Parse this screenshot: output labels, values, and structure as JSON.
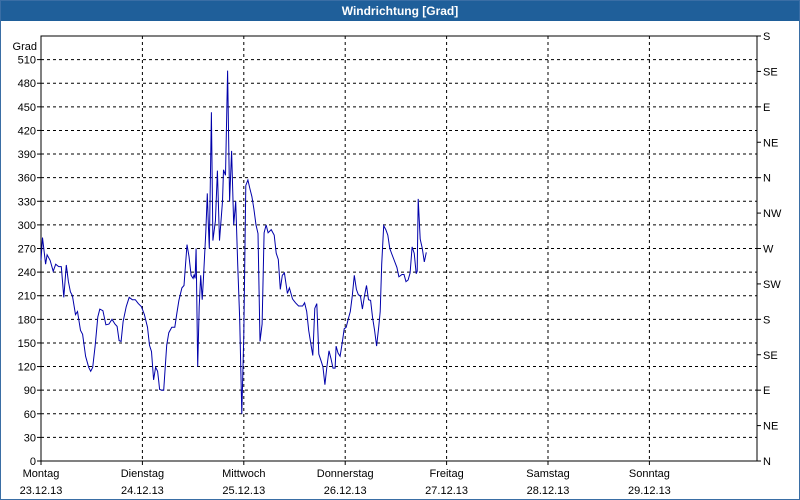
{
  "window": {
    "title": "Windrichtung [Grad]"
  },
  "chart_data": {
    "type": "line",
    "title": "Windrichtung [Grad]",
    "ylabel": "Grad",
    "ylim": [
      0,
      540
    ],
    "y_ticks": [
      0,
      30,
      60,
      90,
      120,
      150,
      180,
      210,
      240,
      270,
      300,
      330,
      360,
      390,
      420,
      450,
      480,
      510
    ],
    "right_axis_labels": [
      "N",
      "NE",
      "E",
      "SE",
      "S",
      "SW",
      "W",
      "NW",
      "N",
      "NE",
      "E",
      "SE",
      "S"
    ],
    "x_range_days": [
      0,
      7
    ],
    "x_ticks": [
      {
        "day": "Montag",
        "date": "23.12.13"
      },
      {
        "day": "Dienstag",
        "date": "24.12.13"
      },
      {
        "day": "Mittwoch",
        "date": "25.12.13"
      },
      {
        "day": "Donnerstag",
        "date": "26.12.13"
      },
      {
        "day": "Freitag",
        "date": "27.12.13"
      },
      {
        "day": "Samstag",
        "date": "28.12.13"
      },
      {
        "day": "Sonntag",
        "date": "29.12.13"
      }
    ],
    "grid": true,
    "series": [
      {
        "color": "#0000aa",
        "points": [
          [
            0.0,
            255
          ],
          [
            0.015,
            284
          ],
          [
            0.045,
            250
          ],
          [
            0.06,
            262
          ],
          [
            0.09,
            255
          ],
          [
            0.12,
            241
          ],
          [
            0.145,
            250
          ],
          [
            0.175,
            247
          ],
          [
            0.2,
            247
          ],
          [
            0.225,
            208
          ],
          [
            0.25,
            249
          ],
          [
            0.27,
            228
          ],
          [
            0.29,
            215
          ],
          [
            0.31,
            210
          ],
          [
            0.34,
            186
          ],
          [
            0.36,
            190
          ],
          [
            0.39,
            166
          ],
          [
            0.41,
            161
          ],
          [
            0.44,
            133
          ],
          [
            0.47,
            119
          ],
          [
            0.49,
            114
          ],
          [
            0.51,
            119
          ],
          [
            0.535,
            147
          ],
          [
            0.56,
            183
          ],
          [
            0.58,
            193
          ],
          [
            0.61,
            191
          ],
          [
            0.64,
            173
          ],
          [
            0.67,
            174
          ],
          [
            0.7,
            180
          ],
          [
            0.73,
            174
          ],
          [
            0.75,
            171
          ],
          [
            0.77,
            153
          ],
          [
            0.79,
            152
          ],
          [
            0.81,
            177
          ],
          [
            0.84,
            196
          ],
          [
            0.87,
            208
          ],
          [
            0.9,
            205
          ],
          [
            0.93,
            205
          ],
          [
            0.96,
            200
          ],
          [
            0.99,
            196
          ],
          [
            1.02,
            186
          ],
          [
            1.05,
            170
          ],
          [
            1.07,
            147
          ],
          [
            1.09,
            139
          ],
          [
            1.11,
            103
          ],
          [
            1.13,
            119
          ],
          [
            1.15,
            114
          ],
          [
            1.16,
            103
          ],
          [
            1.17,
            91
          ],
          [
            1.19,
            90
          ],
          [
            1.21,
            90
          ],
          [
            1.24,
            147
          ],
          [
            1.26,
            163
          ],
          [
            1.29,
            170
          ],
          [
            1.32,
            170
          ],
          [
            1.34,
            188
          ],
          [
            1.36,
            204
          ],
          [
            1.39,
            220
          ],
          [
            1.41,
            223
          ],
          [
            1.44,
            275
          ],
          [
            1.46,
            260
          ],
          [
            1.48,
            236
          ],
          [
            1.5,
            232
          ],
          [
            1.51,
            237
          ],
          [
            1.52,
            232
          ],
          [
            1.53,
            270
          ],
          [
            1.545,
            120
          ],
          [
            1.56,
            196
          ],
          [
            1.575,
            236
          ],
          [
            1.59,
            205
          ],
          [
            1.6,
            226
          ],
          [
            1.625,
            291
          ],
          [
            1.64,
            340
          ],
          [
            1.65,
            302
          ],
          [
            1.66,
            270
          ],
          [
            1.68,
            443
          ],
          [
            1.695,
            280
          ],
          [
            1.72,
            305
          ],
          [
            1.74,
            369
          ],
          [
            1.76,
            280
          ],
          [
            1.79,
            330
          ],
          [
            1.8,
            370
          ],
          [
            1.82,
            363
          ],
          [
            1.84,
            496
          ],
          [
            1.86,
            330
          ],
          [
            1.88,
            394
          ],
          [
            1.9,
            300
          ],
          [
            1.92,
            330
          ],
          [
            1.94,
            250
          ],
          [
            1.96,
            180
          ],
          [
            1.98,
            60
          ],
          [
            2.0,
            160
          ],
          [
            2.02,
            350
          ],
          [
            2.04,
            357
          ],
          [
            2.06,
            346
          ],
          [
            2.08,
            336
          ],
          [
            2.1,
            320
          ],
          [
            2.12,
            300
          ],
          [
            2.14,
            289
          ],
          [
            2.16,
            152
          ],
          [
            2.18,
            174
          ],
          [
            2.2,
            290
          ],
          [
            2.22,
            300
          ],
          [
            2.24,
            290
          ],
          [
            2.27,
            294
          ],
          [
            2.3,
            287
          ],
          [
            2.32,
            264
          ],
          [
            2.34,
            256
          ],
          [
            2.36,
            218
          ],
          [
            2.38,
            236
          ],
          [
            2.4,
            239
          ],
          [
            2.43,
            213
          ],
          [
            2.45,
            220
          ],
          [
            2.48,
            206
          ],
          [
            2.51,
            201
          ],
          [
            2.54,
            197
          ],
          [
            2.58,
            197
          ],
          [
            2.6,
            201
          ],
          [
            2.62,
            190
          ],
          [
            2.64,
            166
          ],
          [
            2.66,
            150
          ],
          [
            2.68,
            134
          ],
          [
            2.7,
            194
          ],
          [
            2.72,
            200
          ],
          [
            2.74,
            136
          ],
          [
            2.76,
            128
          ],
          [
            2.78,
            120
          ],
          [
            2.8,
            97
          ],
          [
            2.82,
            120
          ],
          [
            2.84,
            140
          ],
          [
            2.86,
            130
          ],
          [
            2.88,
            118
          ],
          [
            2.9,
            118
          ],
          [
            2.91,
            146
          ],
          [
            2.93,
            137
          ],
          [
            2.95,
            133
          ],
          [
            2.97,
            150
          ],
          [
            2.99,
            168
          ],
          [
            3.01,
            170
          ],
          [
            3.03,
            180
          ],
          [
            3.05,
            190
          ],
          [
            3.07,
            210
          ],
          [
            3.09,
            236
          ],
          [
            3.11,
            218
          ],
          [
            3.13,
            211
          ],
          [
            3.15,
            210
          ],
          [
            3.17,
            193
          ],
          [
            3.19,
            210
          ],
          [
            3.21,
            223
          ],
          [
            3.23,
            205
          ],
          [
            3.25,
            204
          ],
          [
            3.27,
            182
          ],
          [
            3.29,
            166
          ],
          [
            3.31,
            146
          ],
          [
            3.33,
            170
          ],
          [
            3.345,
            190
          ],
          [
            3.36,
            250
          ],
          [
            3.38,
            299
          ],
          [
            3.4,
            294
          ],
          [
            3.42,
            287
          ],
          [
            3.44,
            270
          ],
          [
            3.46,
            263
          ],
          [
            3.48,
            256
          ],
          [
            3.51,
            246
          ],
          [
            3.53,
            234
          ],
          [
            3.56,
            237
          ],
          [
            3.58,
            237
          ],
          [
            3.6,
            228
          ],
          [
            3.62,
            230
          ],
          [
            3.64,
            239
          ],
          [
            3.66,
            272
          ],
          [
            3.68,
            264
          ],
          [
            3.7,
            238
          ],
          [
            3.71,
            241
          ],
          [
            3.72,
            333
          ],
          [
            3.74,
            282
          ],
          [
            3.76,
            270
          ],
          [
            3.78,
            253
          ],
          [
            3.8,
            265
          ]
        ]
      }
    ]
  }
}
